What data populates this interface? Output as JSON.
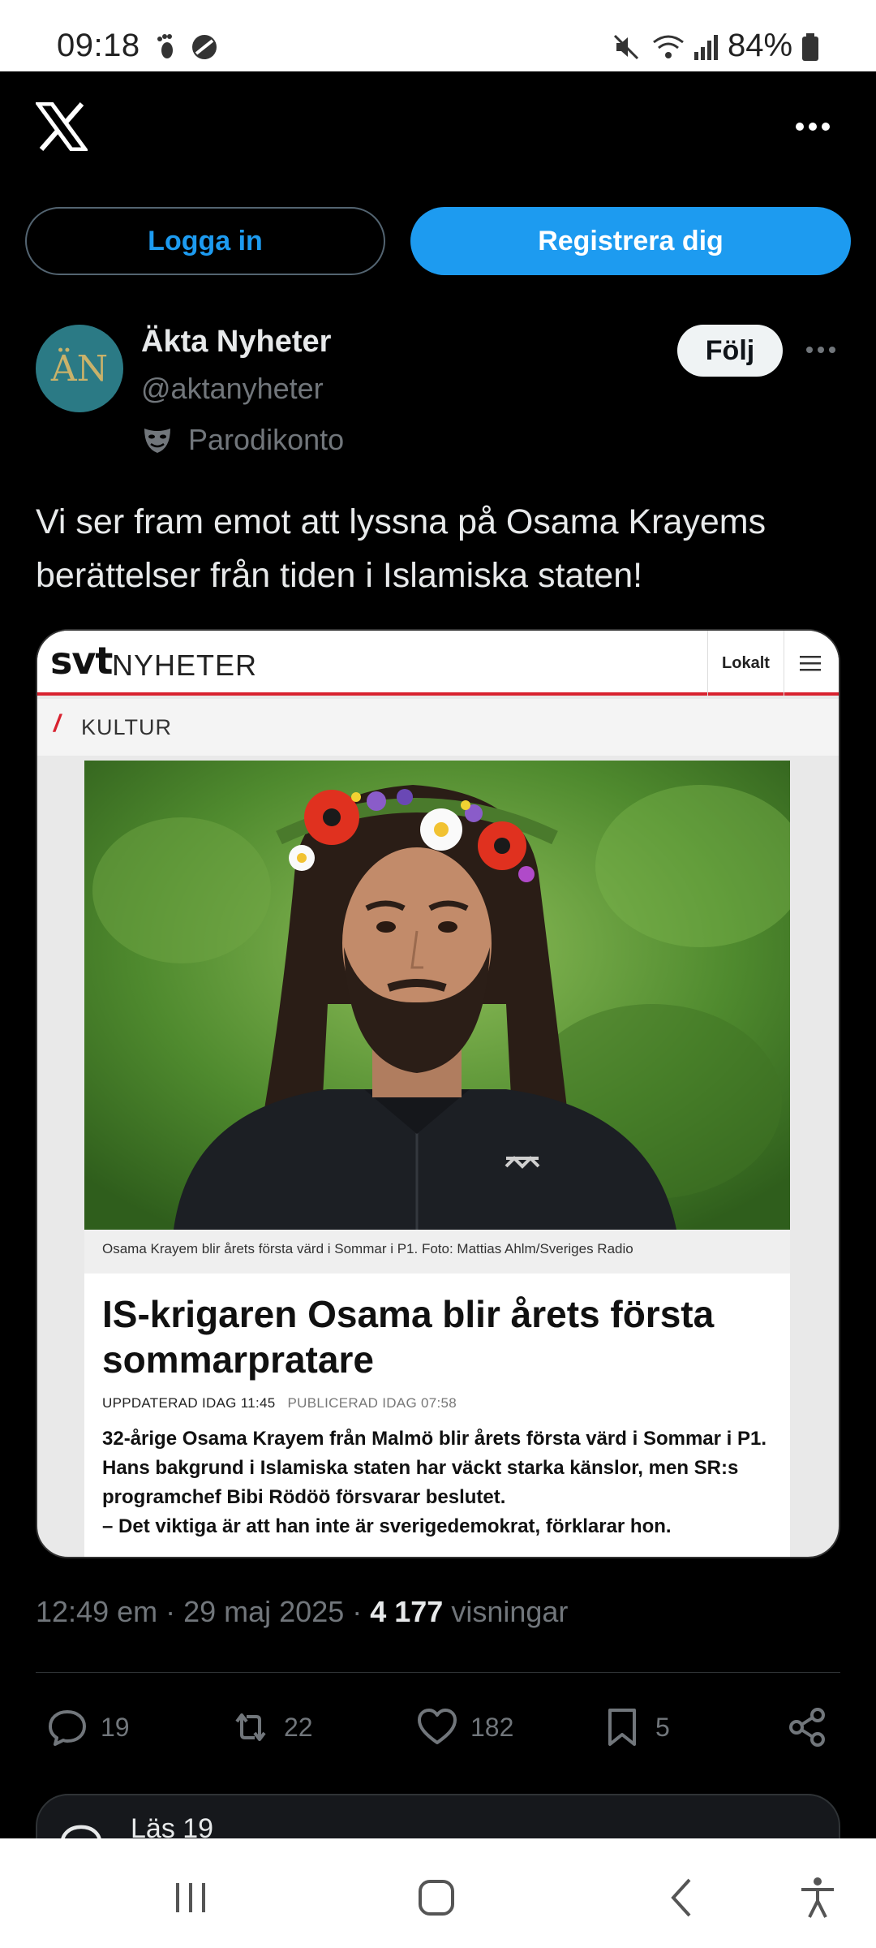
{
  "status_bar": {
    "time": "09:18",
    "battery": "84%",
    "icons": [
      "footprint-icon",
      "blocked-app-icon",
      "mute-icon",
      "wifi-icon",
      "signal-icon",
      "battery-icon"
    ]
  },
  "nav": {
    "logo_icon": "x-logo-icon",
    "more_icon": "more-horizontal-icon",
    "login_label": "Logga in",
    "register_label": "Registrera dig"
  },
  "post": {
    "author_name": "Äkta Nyheter",
    "author_handle": "@aktanyheter",
    "avatar_text": "ÄN",
    "parody_label": "Parodikonto",
    "follow_label": "Följ",
    "text": "Vi ser fram emot att lyssna på Osama Krayems berättelser från tiden i Islamiska staten!",
    "timestamp": "12:49 em · 29 maj 2025 · ",
    "views_count": "4 177",
    "views_label": " visningar"
  },
  "embed": {
    "logo": "svt",
    "logo_suffix": "NYHETER",
    "lokalt": "Lokalt",
    "section": "KULTUR",
    "caption": "Osama Krayem blir årets första värd i Sommar i P1. Foto: Mattias Ahlm/Sveriges Radio",
    "headline": "IS-krigaren Osama blir årets första sommarpratare",
    "updated": "UPPDATERAD IDAG 11:45",
    "published": "PUBLICERAD IDAG 07:58",
    "lead": "32-årige Osama Krayem från Malmö blir årets första värd i Sommar i P1. Hans bakgrund i Islamiska staten har väckt starka känslor, men SR:s programchef Bibi Rödöö försvarar beslutet.\n  – Det viktiga är att han inte är sverigedemokrat, förklarar hon."
  },
  "actions": {
    "replies": "19",
    "reposts": "22",
    "likes": "182",
    "bookmarks": "5"
  },
  "reply_box": {
    "text": "Läs 19"
  },
  "colors": {
    "accent": "#1d9bf0",
    "background": "#000000",
    "secondary_text": "#71767b",
    "svt_red": "#d8222f"
  }
}
